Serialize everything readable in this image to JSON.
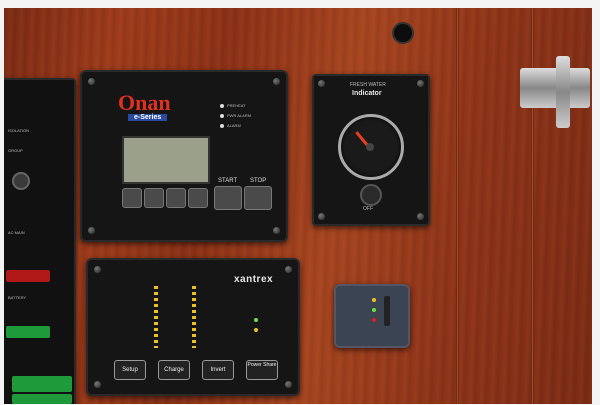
{
  "onan_panel": {
    "brand": "Onan",
    "series": "e-Series",
    "status_labels": [
      "PREHEAT",
      "PWR ALARM",
      "ALARM"
    ],
    "start_label": "START",
    "stop_label": "STOP"
  },
  "water_panel": {
    "header": "FRESH WATER",
    "title": "Indicator",
    "off_label": "OFF"
  },
  "xantrex_panel": {
    "brand": "xantrex",
    "buttons": [
      "Setup",
      "Charge",
      "Invert",
      "Power Share"
    ]
  },
  "colors": {
    "wood": "#8a3016",
    "panel": "#151515",
    "led_amber": "#f0c020",
    "led_green": "#6ee040",
    "led_red": "#e02020"
  }
}
